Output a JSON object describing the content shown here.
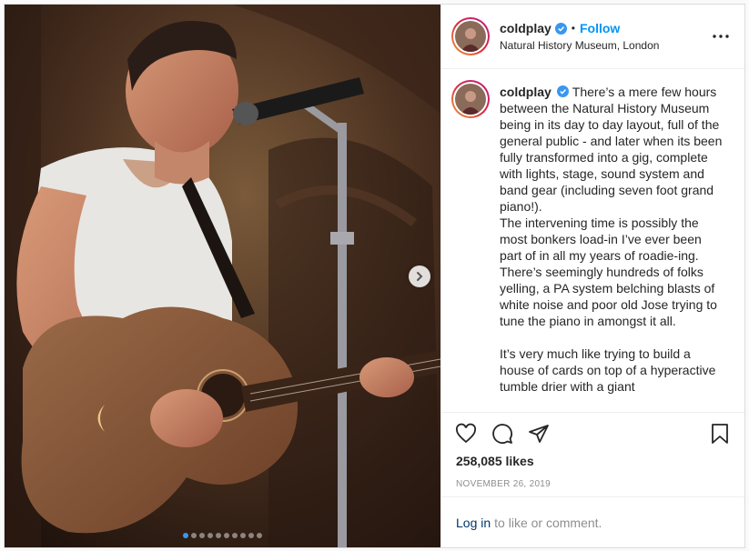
{
  "post": {
    "username": "coldplay",
    "separator": "•",
    "follow_label": "Follow",
    "location": "Natural History Museum, London",
    "caption": "There’s a mere few hours between the Natural History Museum being in its day to day layout, full of the general public - and later when its been fully transformed into a gig, complete with lights, stage, sound system and band gear (including seven foot grand piano!).\nThe intervening time is possibly the most bonkers load-in I’ve ever been part of in all my years of roadie-ing. There’s seemingly hundreds of folks yelling, a PA system belching blasts of white noise and poor old Jose trying to tune the piano in amongst it all.\n\nIt’s very much like trying to build a house of cards on top of a hyperactive tumble drier with a giant",
    "likes": "258,085 likes",
    "date": "November 26, 2019",
    "login_link": "Log in",
    "login_suffix": "to like or comment.",
    "carousel": {
      "total": 10,
      "active_index": 0
    }
  },
  "icons": {
    "verified": "verified-badge-icon",
    "more": "more-options-icon",
    "like": "heart-icon",
    "comment": "comment-icon",
    "share": "share-icon",
    "save": "bookmark-icon",
    "next": "chevron-right-icon"
  },
  "colors": {
    "accent": "#0095f6",
    "link": "#00376b",
    "muted": "#8e8e8e",
    "carousel_active": "#3897f0"
  }
}
